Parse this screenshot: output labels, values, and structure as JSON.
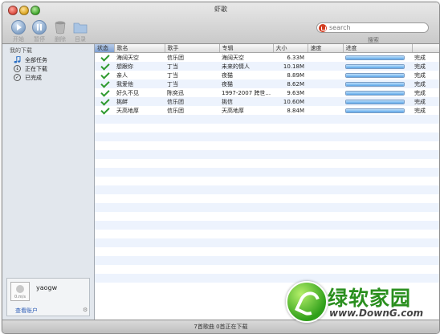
{
  "window": {
    "title": "虾歌"
  },
  "toolbar": {
    "buttons": [
      {
        "label": "开始",
        "icon": "play-icon"
      },
      {
        "label": "暂停",
        "icon": "pause-icon"
      },
      {
        "label": "删除",
        "icon": "trash-icon"
      },
      {
        "label": "目录",
        "icon": "folder-icon"
      }
    ],
    "search": {
      "placeholder": "search",
      "label": "搜索",
      "icon": "xiami-logo-icon"
    }
  },
  "sidebar": {
    "section_title": "我的下载",
    "items": [
      {
        "label": "全部任务",
        "icon": "music-note-icon"
      },
      {
        "label": "正在下载",
        "icon": "download-arrow-icon"
      },
      {
        "label": "已完成",
        "icon": "check-circle-icon"
      }
    ],
    "user": {
      "name": "yaogw",
      "avatar_caption": "0.m/s",
      "account_link": "查看账户",
      "settings_icon": "gear-icon"
    }
  },
  "table": {
    "columns": [
      "状态",
      "歌名",
      "歌手",
      "专辑",
      "大小",
      "速度",
      "进度",
      ""
    ],
    "rows": [
      {
        "name": "海阔天空",
        "artist": "信乐团",
        "album": "海阔天空",
        "size": "6.33M",
        "speed": "",
        "progress": 1.0,
        "status": "完成"
      },
      {
        "name": "想跟你",
        "artist": "丁当",
        "album": "未来的情人",
        "size": "10.18M",
        "speed": "",
        "progress": 1.0,
        "status": "完成"
      },
      {
        "name": "亲人",
        "artist": "丁当",
        "album": "夜猫",
        "size": "8.89M",
        "speed": "",
        "progress": 1.0,
        "status": "完成"
      },
      {
        "name": "我爱他",
        "artist": "丁当",
        "album": "夜猫",
        "size": "8.62M",
        "speed": "",
        "progress": 1.0,
        "status": "完成"
      },
      {
        "name": "好久不见",
        "artist": "陈奕迅",
        "album": "1997-2007 跨世...",
        "size": "9.63M",
        "speed": "",
        "progress": 1.0,
        "status": "完成"
      },
      {
        "name": "挑衅",
        "artist": "信乐团",
        "album": "挑信",
        "size": "10.60M",
        "speed": "",
        "progress": 1.0,
        "status": "完成"
      },
      {
        "name": "天高地厚",
        "artist": "信乐团",
        "album": "天高地厚",
        "size": "8.84M",
        "speed": "",
        "progress": 1.0,
        "status": "完成"
      }
    ]
  },
  "status_bar": {
    "text": "7首歌曲 0首正在下载"
  },
  "watermark": {
    "text": "绿软家园",
    "url": "www.DownG.com"
  },
  "colors": {
    "check": "#2f9a2f",
    "progress": "#5aa5e8",
    "link": "#2c5bb5",
    "watermark": "#2a8f1e"
  }
}
